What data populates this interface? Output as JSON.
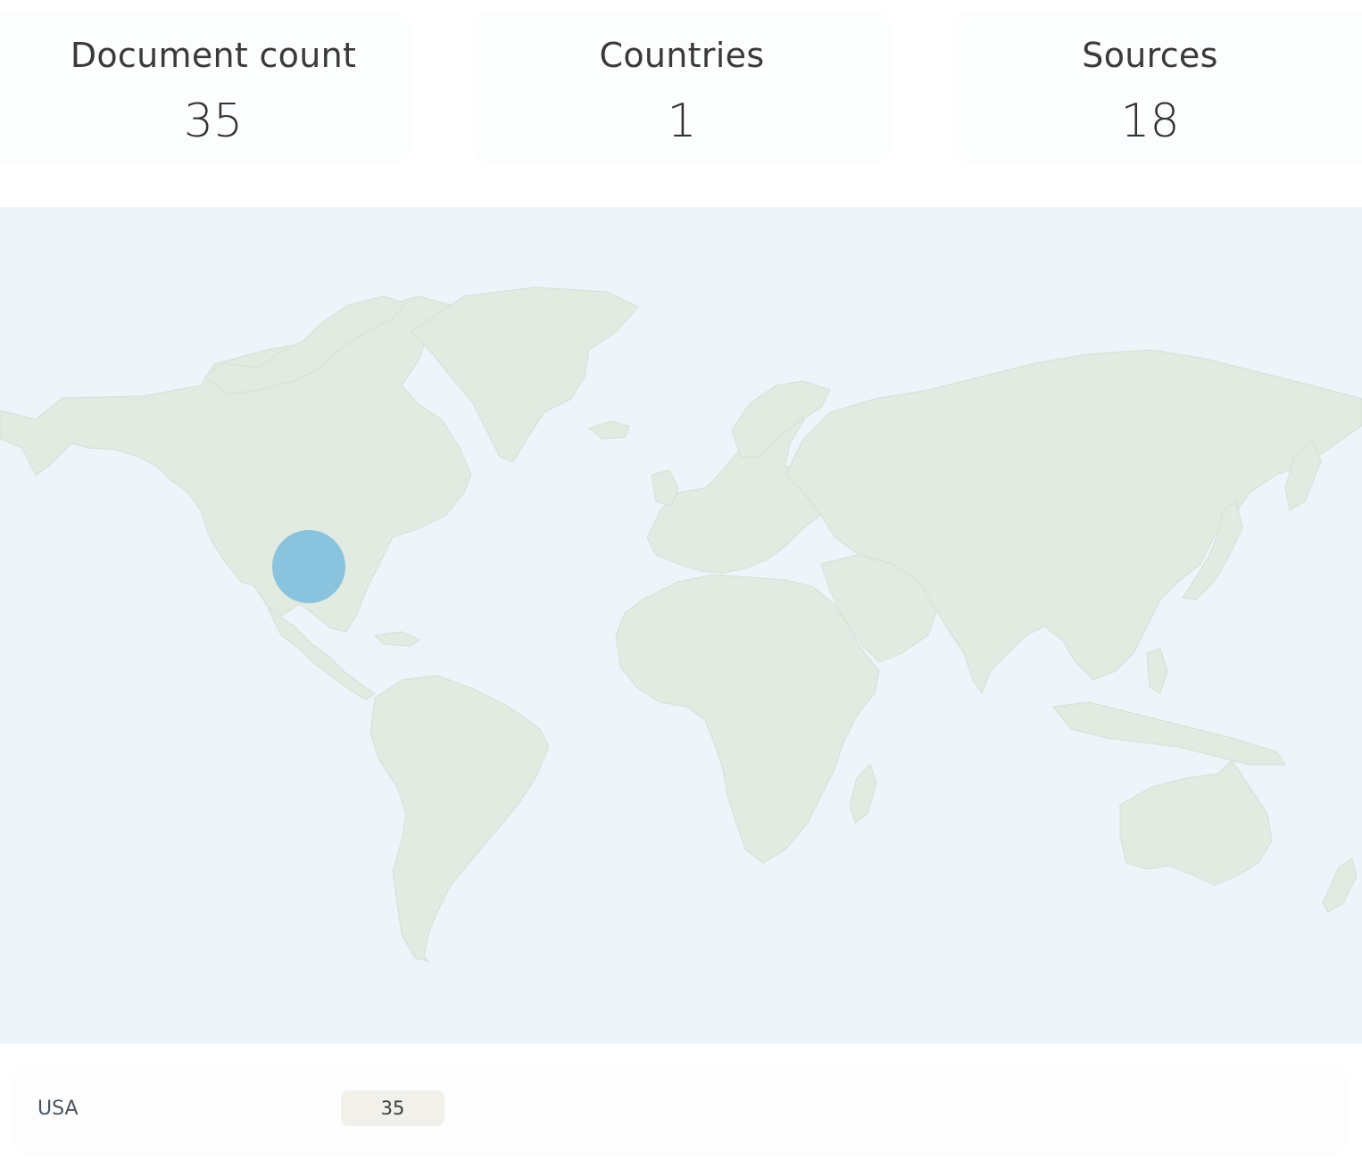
{
  "stats": [
    {
      "label": "Document count",
      "value": "35"
    },
    {
      "label": "Countries",
      "value": "1"
    },
    {
      "label": "Sources",
      "value": "18"
    }
  ],
  "map": {
    "ocean_color": "#edf5fb",
    "land_color": "#e1ebe1",
    "bubble_color": "#8ac3de",
    "markers": [
      {
        "country": "USA",
        "count": 35
      }
    ]
  },
  "table": {
    "rows": [
      {
        "country": "USA",
        "count": "35"
      }
    ]
  }
}
